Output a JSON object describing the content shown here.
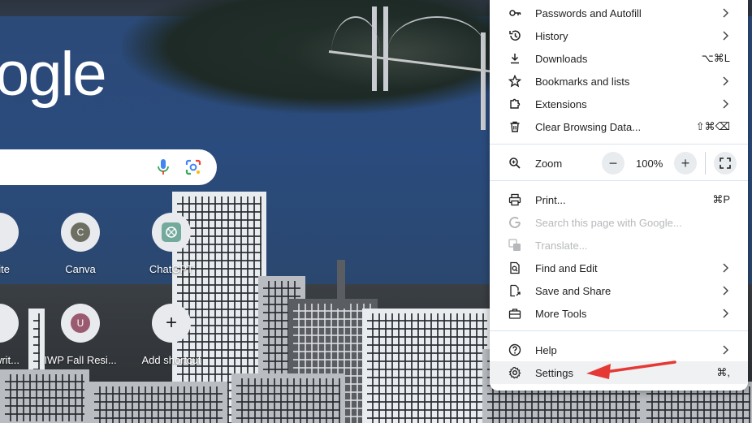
{
  "ntp": {
    "logo_text": "ogle",
    "shortcuts_row1": [
      {
        "label": "site",
        "avatar": ""
      },
      {
        "label": "Canva",
        "avatar": "C",
        "avatar_color": "#6d6f63"
      },
      {
        "label": "ChatGPT",
        "avatar": "",
        "avatar_color": "#74aa9c"
      }
    ],
    "shortcuts_row2": [
      {
        "label": "writ...",
        "avatar": ""
      },
      {
        "label": "IWP Fall Resi...",
        "avatar": "U",
        "avatar_color": "#9a5a70"
      },
      {
        "label": "Add shortcut",
        "avatar": "+"
      }
    ]
  },
  "menu": {
    "items": [
      {
        "label": "Passwords and Autofill",
        "icon": "key-icon",
        "submenu": true
      },
      {
        "label": "History",
        "icon": "history-icon",
        "submenu": true
      },
      {
        "label": "Downloads",
        "icon": "download-icon",
        "shortcut": "⌥⌘L"
      },
      {
        "label": "Bookmarks and lists",
        "icon": "star-icon",
        "submenu": true
      },
      {
        "label": "Extensions",
        "icon": "extension-icon",
        "submenu": true
      },
      {
        "label": "Clear Browsing Data...",
        "icon": "trash-icon",
        "shortcut": "⇧⌘⌫"
      }
    ],
    "zoom": {
      "label": "Zoom",
      "minus": "−",
      "value": "100%",
      "plus": "+"
    },
    "items2": [
      {
        "label": "Print...",
        "icon": "printer-icon",
        "shortcut": "⌘P"
      },
      {
        "label": "Search this page with Google...",
        "icon": "google-g-icon",
        "disabled": true
      },
      {
        "label": "Translate...",
        "icon": "translate-icon",
        "disabled": true
      },
      {
        "label": "Find and Edit",
        "icon": "find-icon",
        "submenu": true
      },
      {
        "label": "Save and Share",
        "icon": "save-share-icon",
        "submenu": true
      },
      {
        "label": "More Tools",
        "icon": "toolbox-icon",
        "submenu": true
      }
    ],
    "items3": [
      {
        "label": "Help",
        "icon": "help-icon",
        "submenu": true
      },
      {
        "label": "Settings",
        "icon": "gear-icon",
        "shortcut": "⌘,"
      }
    ]
  },
  "annotation": {
    "arrow_color": "#e53935"
  }
}
